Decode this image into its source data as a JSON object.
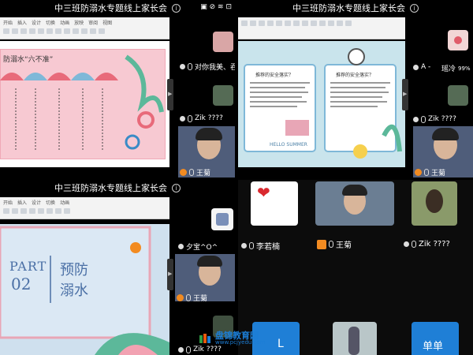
{
  "meeting_title": "中三班防溺水专题线上家长会",
  "status_bar": "▣ ⊘ ≋ ⊡",
  "q1": {
    "menus": [
      "开始",
      "插入",
      "设计",
      "切换",
      "动画",
      "放映",
      "审阅",
      "视图",
      "开发工具"
    ],
    "slide_title": "防溺水“六不准”",
    "participants": [
      {
        "name": "对你我美、吞回礼貌"
      },
      {
        "name": "Zik ????"
      }
    ],
    "video_name": "王菊"
  },
  "q2": {
    "participants": [
      {
        "name": "A -"
      },
      {
        "name": "瑶冷",
        "extra": "99%"
      },
      {
        "name": "Zik ????"
      }
    ],
    "video_name": "王菊",
    "slide_caption_left": "推荐的安全落实？",
    "slide_caption_right": "推荐的安全落实？",
    "slide_footer": "HELLO SUMMER"
  },
  "q3": {
    "menus": [
      "开始",
      "插入",
      "设计",
      "切换",
      "动画"
    ],
    "part_label": "PART",
    "part_number": "02",
    "slide_heading_1": "预防",
    "slide_heading_2": "溺水",
    "participants": [
      {
        "name": "夕宝^O^"
      },
      {
        "name": "王菊"
      },
      {
        "name": "Zik ????"
      }
    ]
  },
  "q4": {
    "tiles": [
      {
        "name": "李若楠"
      },
      {
        "name": "王菊"
      },
      {
        "name": "Zik ????"
      }
    ],
    "bottom_left_text": "L",
    "bottom_right_text": "单单"
  },
  "watermark": {
    "brand": "盘锦教育网",
    "url": "www.pcjyedu.com"
  },
  "colors": {
    "slide_pink": "#f7c9d2",
    "slide_blue": "#cfe0ee",
    "accent_orange": "#f28b21",
    "tile_blue": "#1f7fd6"
  }
}
